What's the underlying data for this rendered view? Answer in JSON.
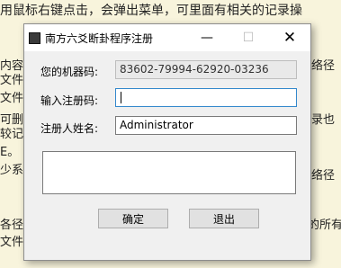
{
  "background": {
    "top_line": "用鼠标右键点击，会弹出菜单，可里面有相关的记录操",
    "left_fragments": [
      "内容",
      "文件",
      "文件,",
      "可删",
      "较记录",
      "E。",
      "少系"
    ],
    "right_fragments": [
      "络径",
      "录也",
      "络径",
      "的所有"
    ],
    "bottom_fragments": [
      "各径",
      "文件操"
    ]
  },
  "dialog": {
    "title": "南方六爻断卦程序注册",
    "controls": {
      "minimize": "—",
      "maximize": "☐",
      "close": "✕"
    },
    "machine_code_label": "您的机器码:",
    "machine_code_value": "83602-79994-62920-03236",
    "reg_code_label": "输入注册码:",
    "reg_code_value": "",
    "registrant_label": "注册人姓名:",
    "registrant_value": "Administrator",
    "memo_text": "",
    "ok_label": "确定",
    "exit_label": "退出"
  }
}
